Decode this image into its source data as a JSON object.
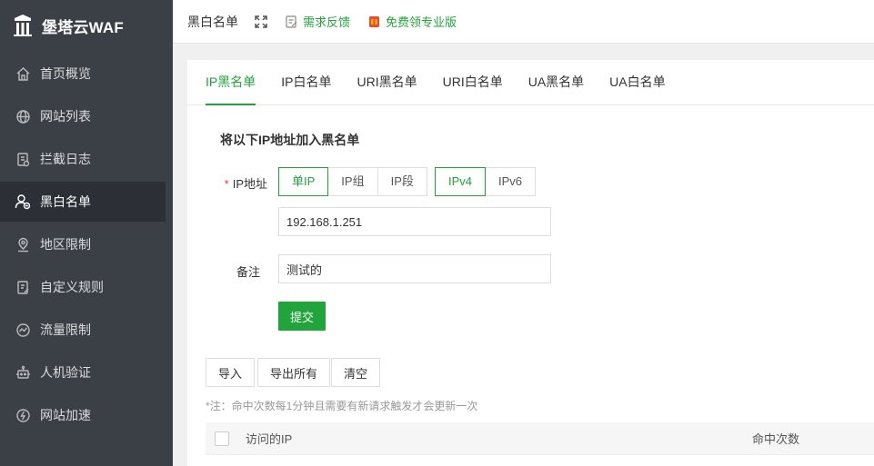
{
  "app": {
    "name": "堡塔云WAF"
  },
  "colors": {
    "accent": "#20a53a",
    "sidebar_bg": "#3b4047",
    "required": "#e23c3c"
  },
  "sidebar": {
    "items": [
      {
        "label": "首页概览",
        "icon": "home-icon"
      },
      {
        "label": "网站列表",
        "icon": "globe-icon"
      },
      {
        "label": "拦截日志",
        "icon": "log-icon"
      },
      {
        "label": "黑白名单",
        "icon": "user-list-icon",
        "active": true
      },
      {
        "label": "地区限制",
        "icon": "location-icon"
      },
      {
        "label": "自定义规则",
        "icon": "rule-icon"
      },
      {
        "label": "流量限制",
        "icon": "traffic-icon"
      },
      {
        "label": "人机验证",
        "icon": "robot-icon"
      },
      {
        "label": "网站加速",
        "icon": "speed-icon"
      }
    ]
  },
  "topbar": {
    "title": "黑白名单",
    "feedback": "需求反馈",
    "pro": "免费领专业版"
  },
  "tabs": [
    "IP黑名单",
    "IP白名单",
    "URI黑名单",
    "URI白名单",
    "UA黑名单",
    "UA白名单"
  ],
  "form": {
    "title": "将以下IP地址加入黑名单",
    "ip_label": "IP地址",
    "required_mark": "*",
    "ip_types": [
      "单IP",
      "IP组",
      "IP段"
    ],
    "ip_versions": [
      "IPv4",
      "IPv6"
    ],
    "ip_value": "192.168.1.251",
    "remark_label": "备注",
    "remark_value": "测试的",
    "submit": "提交"
  },
  "toolbar": {
    "import": "导入",
    "export_all": "导出所有",
    "clear": "清空"
  },
  "note": "*注：命中次数每1分钟且需要有新请求触发才会更新一次",
  "table": {
    "columns": [
      "访问的IP",
      "命中次数"
    ]
  }
}
